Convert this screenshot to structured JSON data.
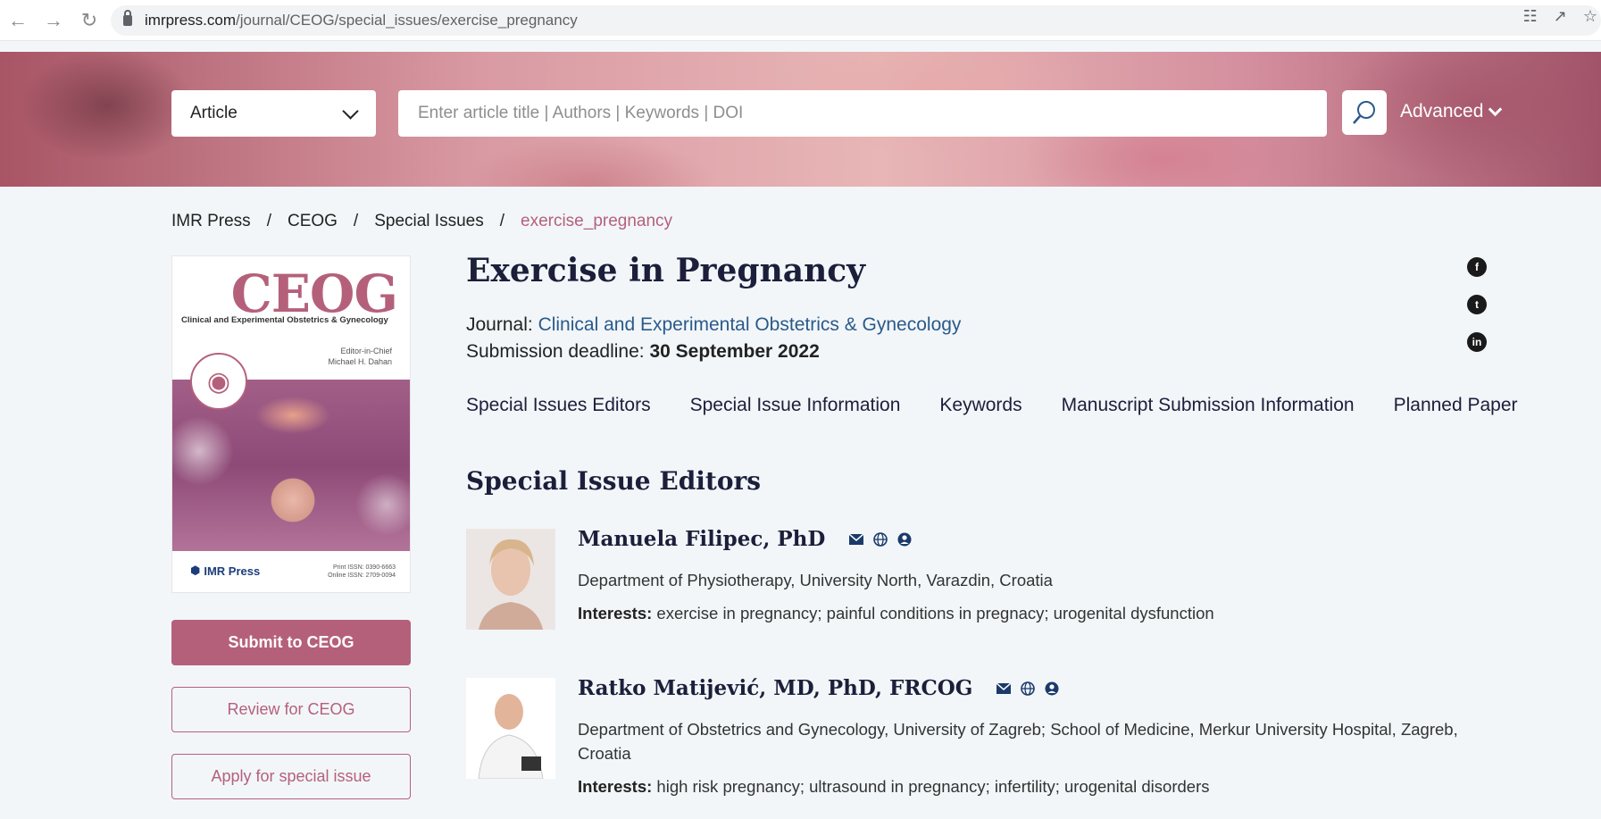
{
  "browser": {
    "url_host": "imrpress.com",
    "url_path": "/journal/CEOG/special_issues/exercise_pregnancy"
  },
  "search": {
    "type_selected": "Article",
    "placeholder": "Enter article title | Authors | Keywords | DOI",
    "advanced_label": "Advanced"
  },
  "breadcrumb": [
    "IMR Press",
    "CEOG",
    "Special Issues",
    "exercise_pregnancy"
  ],
  "cover": {
    "title": "CEOG",
    "subtitle": "Clinical and Experimental Obstetrics & Gynecology",
    "editor_role": "Editor-in-Chief",
    "editor_name": "Michael H. Dahan",
    "publisher": "IMR Press",
    "print_issn": "Print ISSN: 0390-6663",
    "online_issn": "Online ISSN: 2709-0094"
  },
  "sidebar": {
    "submit_label": "Submit to CEOG",
    "review_label": "Review for CEOG",
    "apply_label": "Apply for special issue"
  },
  "main": {
    "title": "Exercise in Pregnancy",
    "journal_label": "Journal:",
    "journal_name": "Clinical and Experimental Obstetrics & Gynecology",
    "deadline_label": "Submission deadline:",
    "deadline_value": "30 September 2022",
    "tabs": [
      "Special Issues Editors",
      "Special Issue Information",
      "Keywords",
      "Manuscript Submission Information",
      "Planned Paper"
    ],
    "section_title": "Special Issue Editors",
    "interests_label": "Interests:",
    "editors": [
      {
        "name": "Manuela Filipec, PhD",
        "department": "Department of Physiotherapy, University North, Varazdin, Croatia",
        "interests": "exercise in pregnancy; painful conditions in pregnacy; urogenital dysfunction"
      },
      {
        "name": "Ratko Matijević, MD, PhD, FRCOG",
        "department": "Department of Obstetrics and Gynecology, University of Zagreb; School of Medicine, Merkur University Hospital, Zagreb, Croatia",
        "interests": "high risk pregnancy; ultrasound in pregnancy; infertility; urogenital disorders"
      }
    ]
  },
  "colors": {
    "accent": "#b5607b",
    "link": "#2a5a8a",
    "heading": "#1b1f3a",
    "background": "#f2f6f9"
  },
  "icons": {
    "social": [
      "facebook-icon",
      "twitter-icon",
      "linkedin-icon"
    ],
    "editor": [
      "mail-icon",
      "globe-icon",
      "profile-icon"
    ]
  }
}
